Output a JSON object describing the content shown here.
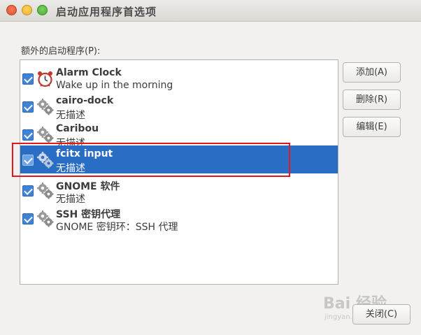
{
  "window": {
    "title": "启动应用程序首选项"
  },
  "section_label": "额外的启动程序(P):",
  "startup_items": [
    {
      "name": "Alarm Clock",
      "description": "Wake up in the morning",
      "checked": true,
      "icon": "alarm-clock-icon",
      "selected": false
    },
    {
      "name": "cairo-dock",
      "description": "无描述",
      "checked": true,
      "icon": "gears-icon",
      "selected": false
    },
    {
      "name": "Caribou",
      "description": "无描述",
      "checked": true,
      "icon": "gears-icon",
      "selected": false
    },
    {
      "name": "fcitx input",
      "description": "无描述",
      "checked": true,
      "icon": "gears-icon",
      "selected": true
    },
    {
      "name": "GNOME 软件",
      "description": "无描述",
      "checked": true,
      "icon": "gears-icon",
      "selected": false
    },
    {
      "name": "SSH 密钥代理",
      "description": "GNOME 密钥环：SSH 代理",
      "checked": true,
      "icon": "gears-icon",
      "selected": false
    }
  ],
  "buttons": {
    "add": "添加(A)",
    "remove": "删除(R)",
    "edit": "编辑(E)",
    "close": "关闭(C)"
  },
  "watermark": {
    "main": "Bai 经验",
    "sub": "jingyan.baidu.com"
  },
  "colors": {
    "selection": "#2a6dc4",
    "checkbox": "#3e83d8",
    "highlight_box": "#e3161c"
  }
}
